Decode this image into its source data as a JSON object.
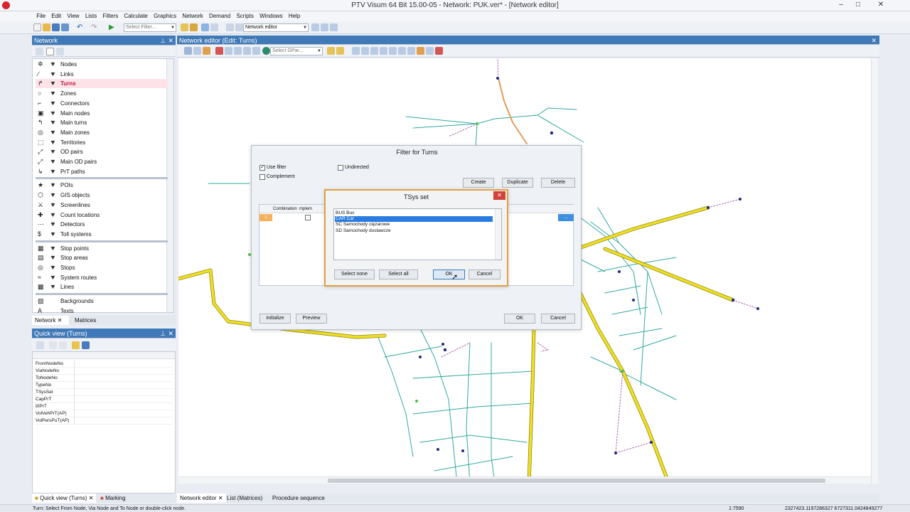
{
  "app": {
    "title": "PTV Visum 64 Bit 15.00-05 - Network: PUK.ver* - [Network editor]",
    "menus": [
      "File",
      "Edit",
      "View",
      "Lists",
      "Filters",
      "Calculate",
      "Graphics",
      "Network",
      "Demand",
      "Scripts",
      "Windows",
      "Help"
    ],
    "window_buttons": [
      "–",
      "□",
      "✕"
    ]
  },
  "toolbar": {
    "filter_placeholder": "Select Filter...",
    "view_combo": "Network editor"
  },
  "network_panel": {
    "title": "Network",
    "items_a": [
      {
        "label": "Nodes",
        "icon": "node-icon",
        "glyph": "✲"
      },
      {
        "label": "Links",
        "icon": "link-icon",
        "glyph": "∕"
      },
      {
        "label": "Turns",
        "icon": "turn-icon",
        "glyph": "↱",
        "selected": true
      },
      {
        "label": "Zones",
        "icon": "zone-icon",
        "glyph": "○"
      },
      {
        "label": "Connectors",
        "icon": "connector-icon",
        "glyph": "⌐"
      },
      {
        "label": "Main nodes",
        "icon": "main-node-icon",
        "glyph": "▣"
      },
      {
        "label": "Main turns",
        "icon": "main-turn-icon",
        "glyph": "↰"
      },
      {
        "label": "Main zones",
        "icon": "main-zone-icon",
        "glyph": "◎"
      },
      {
        "label": "Territories",
        "icon": "territory-icon",
        "glyph": "⬚"
      },
      {
        "label": "OD pairs",
        "icon": "od-pair-icon",
        "glyph": "⤢"
      },
      {
        "label": "Main OD pairs",
        "icon": "main-od-pair-icon",
        "glyph": "⤢"
      },
      {
        "label": "PrT paths",
        "icon": "prt-path-icon",
        "glyph": "↳"
      }
    ],
    "items_b": [
      {
        "label": "POIs",
        "icon": "poi-icon",
        "glyph": "★"
      },
      {
        "label": "GIS objects",
        "icon": "gis-icon",
        "glyph": "⬡"
      },
      {
        "label": "Screenlines",
        "icon": "screenline-icon",
        "glyph": "⚔"
      },
      {
        "label": "Count locations",
        "icon": "count-location-icon",
        "glyph": "✚"
      },
      {
        "label": "Detectors",
        "icon": "detector-icon",
        "glyph": "⋯"
      },
      {
        "label": "Toll systems",
        "icon": "toll-icon",
        "glyph": "$"
      }
    ],
    "items_c": [
      {
        "label": "Stop points",
        "icon": "stop-point-icon",
        "glyph": "▦"
      },
      {
        "label": "Stop areas",
        "icon": "stop-area-icon",
        "glyph": "▤"
      },
      {
        "label": "Stops",
        "icon": "stop-icon",
        "glyph": "◎"
      },
      {
        "label": "System routes",
        "icon": "system-route-icon",
        "glyph": "≈"
      },
      {
        "label": "Lines",
        "icon": "line-icon",
        "glyph": "▩"
      }
    ],
    "items_d": [
      {
        "label": "Backgrounds",
        "icon": "background-icon",
        "glyph": "▧"
      },
      {
        "label": "Texts",
        "icon": "text-icon",
        "glyph": "A"
      }
    ],
    "tabs": [
      "Network",
      "Matrices"
    ]
  },
  "quick_view": {
    "title": "Quick view (Turns)",
    "attributes": [
      "FromNodeNo",
      "ViaNodeNo",
      "ToNodeNo",
      "TypeNo",
      "TSysSet",
      "CapPrT",
      "t0PrT",
      "VolVehPrT(AP)",
      "VolPersPuT(AP)"
    ],
    "bottom_tabs": [
      "Quick view (Turns)",
      "Marking"
    ]
  },
  "editor": {
    "title": "Network editor (Edit: Turns)",
    "gpa_placeholder": "Select GPar...",
    "bottom_tabs": [
      "Network editor",
      "List (Matrices)",
      "Procedure sequence"
    ]
  },
  "filter_dialog": {
    "title": "Filter for Turns",
    "use_filter": "Use filter",
    "complement": "Complement",
    "undirected": "Undirected",
    "create": "Create",
    "duplicate": "Duplicate",
    "delete": "Delete",
    "col_header": "Combination",
    "col_header2": "mplem",
    "row_no": "1",
    "ellipsis": "...",
    "initialize": "Initialize",
    "preview": "Preview",
    "ok": "OK",
    "cancel": "Cancel"
  },
  "tsys_dialog": {
    "title": "TSys set",
    "items": [
      "BUS Bus",
      "CAR Car",
      "SC Samochody ciężarowe",
      "SD Samochody dostawcze"
    ],
    "selected_index": 1,
    "select_none": "Select none",
    "select_all": "Select all",
    "ok": "OK",
    "cancel": "Cancel"
  },
  "status": {
    "hint": "Turn: Select From Node, Via Node and To Node or double-click node.",
    "scale": "1:7590",
    "coords": "2327423.1197286327 6727311.0424849277"
  },
  "colors": {
    "accent": "#3f79b7",
    "road_yellow": "#f0e020",
    "road_teal": "#2fa8a0",
    "road_orange": "#e39a5a",
    "selected_turn": "#c0143c",
    "dialog_border": "#e0a040"
  }
}
